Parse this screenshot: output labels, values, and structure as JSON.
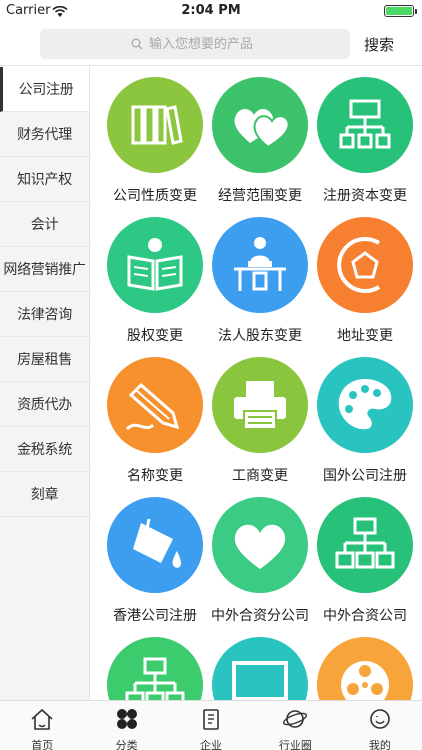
{
  "status": {
    "carrier": "Carrier",
    "time": "2:04 PM"
  },
  "search": {
    "placeholder": "输入您想要的产品",
    "button": "搜索"
  },
  "sidebar": {
    "items": [
      {
        "label": "公司注册",
        "active": true
      },
      {
        "label": "财务代理"
      },
      {
        "label": "知识产权"
      },
      {
        "label": "会计"
      },
      {
        "label": "网络营销推广"
      },
      {
        "label": "法律咨询"
      },
      {
        "label": "房屋租售"
      },
      {
        "label": "资质代办"
      },
      {
        "label": "金税系统"
      },
      {
        "label": "刻章"
      }
    ]
  },
  "grid": {
    "items": [
      {
        "label": "公司性质变更",
        "color": "#8cc63f",
        "icon": "books-icon"
      },
      {
        "label": "经营范围变更",
        "color": "#3cc26a",
        "icon": "hearts-icon"
      },
      {
        "label": "注册资本变更",
        "color": "#27c179",
        "icon": "org-chart-icon"
      },
      {
        "label": "股权变更",
        "color": "#2ec885",
        "icon": "open-book-icon"
      },
      {
        "label": "法人股东变更",
        "color": "#3d9ef0",
        "icon": "reader-icon"
      },
      {
        "label": "地址变更",
        "color": "#f77f30",
        "icon": "pentagon-icon"
      },
      {
        "label": "名称变更",
        "color": "#f7912e",
        "icon": "pencil-icon"
      },
      {
        "label": "工商变更",
        "color": "#8ac53e",
        "icon": "printer-icon"
      },
      {
        "label": "国外公司注册",
        "color": "#2ac4c0",
        "icon": "palette-icon"
      },
      {
        "label": "香港公司注册",
        "color": "#3d9ef0",
        "icon": "paint-bucket-icon"
      },
      {
        "label": "中外合资分公司",
        "color": "#3ccb84",
        "icon": "heart-icon"
      },
      {
        "label": "中外合资公司",
        "color": "#27c179",
        "icon": "hierarchy-icon"
      },
      {
        "label": "",
        "color": "#3ccb6d",
        "icon": "hierarchy-icon"
      },
      {
        "label": "",
        "color": "#2ac4c0",
        "icon": "monitor-icon"
      },
      {
        "label": "",
        "color": "#f7a43a",
        "icon": "reel-icon"
      }
    ]
  },
  "tabbar": {
    "items": [
      {
        "label": "首页",
        "icon": "home-icon"
      },
      {
        "label": "分类",
        "icon": "category-icon",
        "active": true
      },
      {
        "label": "企业",
        "icon": "document-icon"
      },
      {
        "label": "行业圈",
        "icon": "planet-icon"
      },
      {
        "label": "我的",
        "icon": "smile-icon"
      }
    ]
  }
}
